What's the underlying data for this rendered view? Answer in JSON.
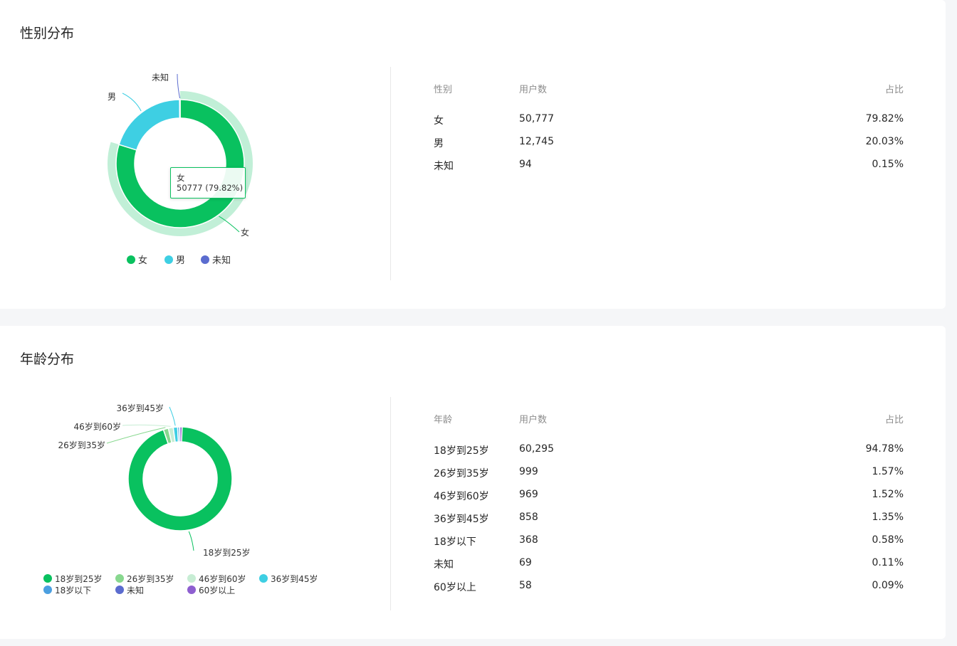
{
  "gender": {
    "title": "性别分布",
    "table": {
      "headers": [
        "性别",
        "用户数",
        "占比"
      ],
      "rows": [
        {
          "label": "女",
          "count": "50,777",
          "pct": "79.82%"
        },
        {
          "label": "男",
          "count": "12,745",
          "pct": "20.03%"
        },
        {
          "label": "未知",
          "count": "94",
          "pct": "0.15%"
        }
      ]
    },
    "tooltip": {
      "name": "女",
      "value": "50777 (79.82%)"
    }
  },
  "age": {
    "title": "年龄分布",
    "table": {
      "headers": [
        "年龄",
        "用户数",
        "占比"
      ],
      "rows": [
        {
          "label": "18岁到25岁",
          "count": "60,295",
          "pct": "94.78%"
        },
        {
          "label": "26岁到35岁",
          "count": "999",
          "pct": "1.57%"
        },
        {
          "label": "46岁到60岁",
          "count": "969",
          "pct": "1.52%"
        },
        {
          "label": "36岁到45岁",
          "count": "858",
          "pct": "1.35%"
        },
        {
          "label": "18岁以下",
          "count": "368",
          "pct": "0.58%"
        },
        {
          "label": "未知",
          "count": "69",
          "pct": "0.11%"
        },
        {
          "label": "60岁以上",
          "count": "58",
          "pct": "0.09%"
        }
      ]
    }
  },
  "chart_data": [
    {
      "type": "pie",
      "title": "性别分布",
      "categories": [
        "女",
        "男",
        "未知"
      ],
      "values": [
        50777,
        12745,
        94
      ],
      "colors": [
        "#09c15f",
        "#3ecfe3",
        "#5b6ccf"
      ],
      "legend": "bottom",
      "highlighted": "女",
      "outside_labels": [
        "女",
        "男",
        "未知"
      ]
    },
    {
      "type": "pie",
      "title": "年龄分布",
      "categories": [
        "18岁到25岁",
        "26岁到35岁",
        "46岁到60岁",
        "36岁到45岁",
        "18岁以下",
        "未知",
        "60岁以上"
      ],
      "values": [
        60295,
        999,
        969,
        858,
        368,
        69,
        58
      ],
      "colors": [
        "#09c15f",
        "#88d88f",
        "#c7edd4",
        "#3ecfe3",
        "#4b9fe0",
        "#5b6ccf",
        "#8e5fd0"
      ],
      "legend": "bottom",
      "outside_labels": [
        "18岁到25岁",
        "26岁到35岁",
        "46岁到60岁",
        "36岁到45岁"
      ]
    }
  ]
}
